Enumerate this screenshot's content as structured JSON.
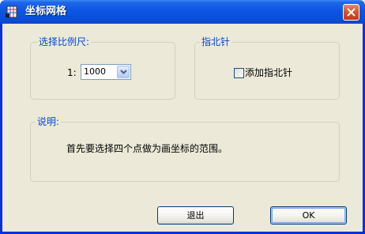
{
  "window": {
    "title": "坐标网格",
    "icon": "grid-app-icon",
    "close_icon": "close-x-icon"
  },
  "scale_group": {
    "label": "选择比例尺:",
    "prefix": "1:",
    "selected_value": "1000"
  },
  "north_arrow_group": {
    "label": "指北针",
    "checkbox_label": "添加指北针",
    "checked": false
  },
  "description_group": {
    "label": "说明:",
    "text": "首先要选择四个点做为画坐标的范围。"
  },
  "buttons": {
    "exit_label": "退出",
    "ok_label": "OK"
  },
  "colors": {
    "title_bar": "#0a4fdc",
    "client_background": "#ece9d8",
    "group_label": "#0046d5",
    "close_button": "#d8532a"
  }
}
